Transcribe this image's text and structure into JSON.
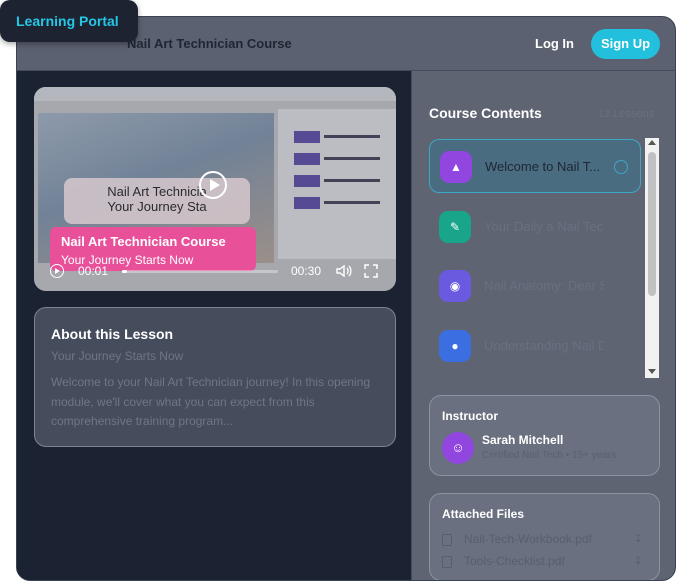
{
  "brand": {
    "name": "Learning Portal"
  },
  "header": {
    "course_title": "Nail Art Technician Course",
    "login_label": "Log In",
    "signup_label": "Sign Up"
  },
  "video": {
    "title_card_line1": "Nail Art Technicia",
    "title_card_line2": "Your Journey Sta",
    "banner_title": "Nail Art Technician Course",
    "banner_subtitle": "Your Journey Starts Now",
    "current_time": "00:01",
    "total_time": "00:30",
    "progress": 0.03
  },
  "about": {
    "heading": "About this Lesson",
    "subtitle": "Your Journey Starts Now",
    "description": "Welcome to your Nail Art Technician journey! In this opening module, we'll cover what you can expect from this comprehensive training program..."
  },
  "course_contents": {
    "heading": "Course Contents",
    "count_text": "12 Lessons",
    "lessons": [
      {
        "title": "Welcome to Nail T...",
        "icon": "rocket-icon",
        "color": "#9146e0",
        "active": true
      },
      {
        "title": "Your Daily a Nail Techi...",
        "icon": "brush-icon",
        "color": "#18a58a",
        "active": false
      },
      {
        "title": "Nail Anatomy: Dear So...",
        "icon": "palette-icon",
        "color": "#6a5ae0",
        "active": false
      },
      {
        "title": "Understanding Nail Dis...",
        "icon": "person-icon",
        "color": "#3b6ee0",
        "active": false
      }
    ]
  },
  "instructor": {
    "heading": "Instructor",
    "name": "Sarah Mitchell",
    "role": "Certified Nail Tech • 15+ years"
  },
  "files": {
    "heading": "Attached Files",
    "items": [
      {
        "name": "Nail-Tech-Workbook.pdf"
      },
      {
        "name": "Tools-Checklist.pdf"
      }
    ]
  },
  "colors": {
    "accent": "#22c0dc",
    "banner": "#e8509a",
    "panel_dark": "#1b2232"
  }
}
